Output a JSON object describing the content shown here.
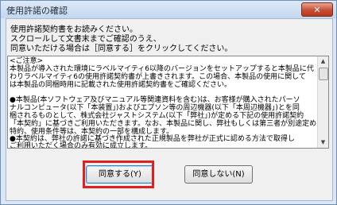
{
  "window": {
    "title": "使用許諾の確認",
    "close_label": "✕"
  },
  "instructions": [
    "使用許諾契約書をお読みください。",
    "スクロールして文書末までご確認のうえ、",
    "同意いただける場合は［同意する］をクリックしてください。"
  ],
  "agreement": {
    "lines": [
      "<ご注意>",
      "本製品が導入された環境にラベルマイティ6以降のバージョンをセットアップすると本製品に代",
      "わりラベルマイティ6の使用許諾契約書が上書きされます。この場合、本製品の使用に関して",
      "は本製品の同梱時用に記載された使用許諾契約書をご確認ください。",
      "",
      "●本製品(本ソフトウェア及びマニュアル等関連資料を含む)は、お客様が購入されたパーソ",
      "ナルコンピュータ(以下「本装置」)およびエプソン等の周辺機器(以下「本周辺機器」)とを同",
      "梱されるものとして、株式会社ジャストシステム(以下「弊社」)が定める下記の使用許諾契約",
      "「本契約」に基づきご利用いただきます。なお、本製品に関し、弊社もしくは第三者が別途定める",
      "特約、使用条件等は、本契約の一部を構成します。",
      "●本契約は、弊社の許諾に基づき作成された正規製品を弊社が正式に認める方法で取得し",
      "ご利用いただく場合のみ有効に成立します。",
      "●お客様が本ソフトウェアをインストールした時点、又はご使用を開始した時点で本契約が成立"
    ]
  },
  "buttons": {
    "agree": "同意する(Y)",
    "disagree": "同意しない(N)"
  }
}
